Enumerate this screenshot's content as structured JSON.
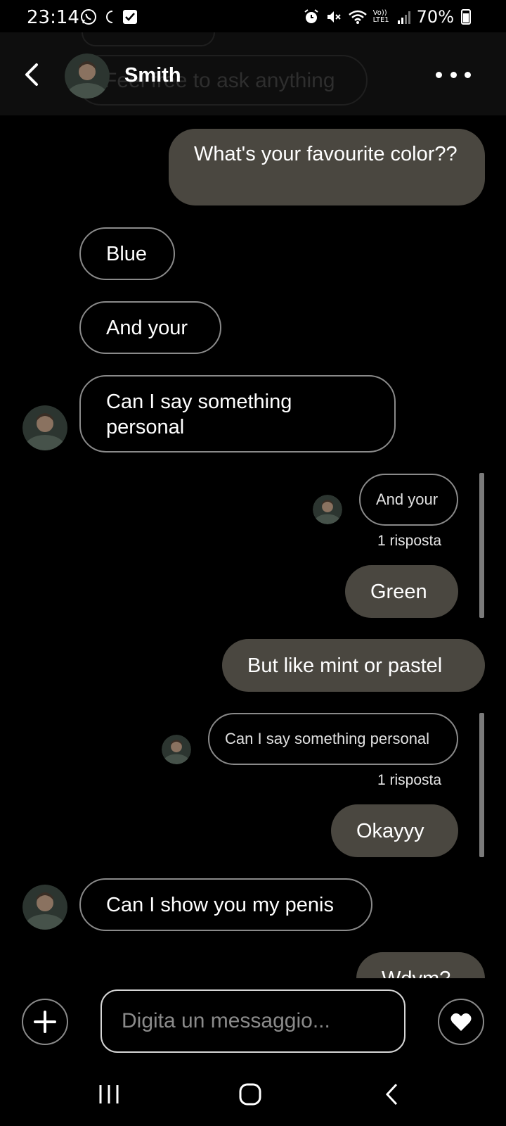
{
  "status_bar": {
    "time": "23:14",
    "battery": "70%",
    "network": "Vo)) LTE1"
  },
  "header": {
    "contact_name": "Smith",
    "ghost_placeholder": "Feel free to ask anything",
    "icons": [
      "back-arrow-icon",
      "more-options-icon"
    ]
  },
  "messages": [
    {
      "sender": "me",
      "text": "What's your favourite color??"
    },
    {
      "sender": "them",
      "text": "Blue"
    },
    {
      "sender": "them",
      "text": "And your"
    },
    {
      "sender": "them",
      "text": "Can I say something personal"
    },
    {
      "sender": "me",
      "quoted": "And your",
      "reply_count": "1 risposta",
      "text": "Green"
    },
    {
      "sender": "me",
      "text": "But like mint or pastel"
    },
    {
      "sender": "me",
      "quoted": "Can I say something personal",
      "reply_count": "1 risposta",
      "text": "Okayyy"
    },
    {
      "sender": "them",
      "text": "Can I show you my penis"
    },
    {
      "sender": "me",
      "text": "Wdym?"
    }
  ],
  "composer": {
    "placeholder": "Digita un messaggio...",
    "value": ""
  },
  "colors": {
    "background": "#000000",
    "my_bubble": "#4a4740",
    "their_border": "#8a8a8a",
    "header_bg": "#0e0e0e"
  }
}
